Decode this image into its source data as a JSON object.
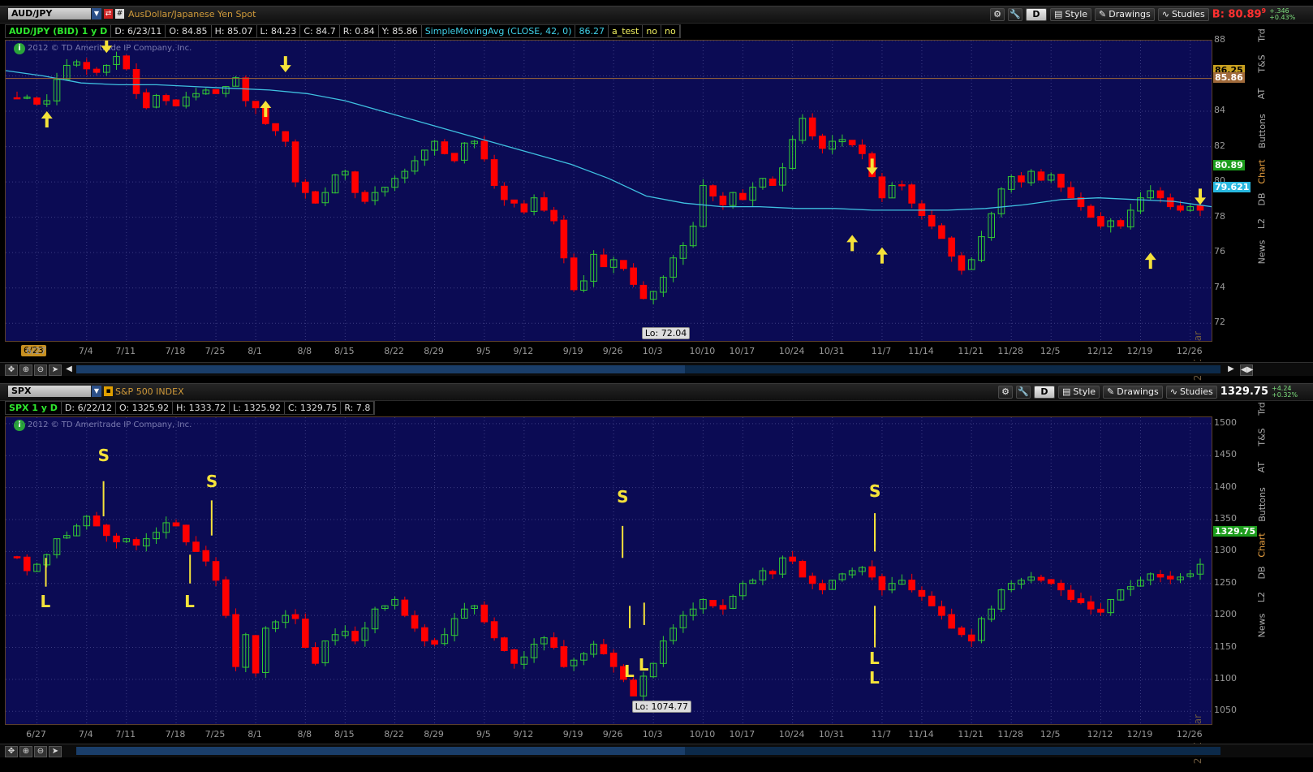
{
  "top": {
    "symbol": "AUD/JPY",
    "description": "AusDollar/Japanese Yen Spot",
    "toolbar": {
      "d_label": "D",
      "style_label": "Style",
      "drawings_label": "Drawings",
      "studies_label": "Studies"
    },
    "bid": "B: 80.89",
    "bid_sup": "9",
    "change_abs": "+.346",
    "change_pct": "+0.43%",
    "info_bar": [
      "AUD/JPY (BID) 1 y D",
      "D: 6/23/11",
      "O: 84.85",
      "H: 85.07",
      "L: 84.23",
      "C: 84.7",
      "R: 0.84",
      "Y: 85.86"
    ],
    "study": "SimpleMovingAvg (CLOSE, 42, 0)",
    "study_value": "86.27",
    "extra": [
      "a_test",
      "no",
      "no"
    ],
    "copyright": "2012 © TD Ameritrade IP Company, Inc.",
    "year_label": "2011 year",
    "date_badge": "6/23",
    "lo_label": "Lo: 72.04",
    "price_badges": {
      "a": "86.25",
      "b": "85.86",
      "last": "80.89",
      "sma": "79.621"
    }
  },
  "bottom": {
    "symbol": "SPX",
    "description": "S&P 500 INDEX",
    "toolbar": {
      "d_label": "D",
      "style_label": "Style",
      "drawings_label": "Drawings",
      "studies_label": "Studies"
    },
    "last": "1329.75",
    "change_abs": "+4.24",
    "change_pct": "+0.32%",
    "info_bar": [
      "SPX 1 y D",
      "D: 6/22/12",
      "O: 1325.92",
      "H: 1333.72",
      "L: 1325.92",
      "C: 1329.75",
      "R: 7.8"
    ],
    "copyright": "2012 © TD Ameritrade IP Company, Inc.",
    "year_label": "2011 year",
    "lo_label": "Lo: 1074.77",
    "price_badge": "1329.75"
  },
  "side_tabs": [
    "Trd",
    "T&S",
    "AT",
    "Buttons",
    "Chart",
    "DB",
    "L2",
    "News"
  ],
  "icons": {
    "symbol_dropdown": "chevron-down-icon",
    "gadget": "gear-icon",
    "wrench": "wrench-icon",
    "style": "style-icon",
    "drawings": "pencil-icon",
    "studies": "studies-icon",
    "info": "info-icon",
    "pan": "pan-icon",
    "zoom_in": "zoom-in-icon",
    "zoom_out": "zoom-out-icon",
    "pointer": "pointer-icon",
    "scroll_left": "arrow-left-icon",
    "scroll_right": "arrow-right-icon",
    "expand": "expand-icon"
  },
  "colors": {
    "bg": "#0b0b54",
    "up": "#33cc33",
    "down": "#ff0000",
    "sma": "#3fc0e0",
    "signal": "#f5e23a",
    "frame": "#5a3f2a"
  },
  "chart_data": [
    {
      "type": "candlestick",
      "title": "AUD/JPY (BID) 1 y D",
      "ylim": [
        71,
        88
      ],
      "y_ticks": [
        72,
        74,
        76,
        78,
        80,
        82,
        84,
        86,
        88
      ],
      "x_ticks": [
        "6/27",
        "7/4",
        "7/11",
        "7/18",
        "7/25",
        "8/1",
        "8/8",
        "8/15",
        "8/22",
        "8/29",
        "9/5",
        "9/12",
        "9/19",
        "9/26",
        "10/3",
        "10/10",
        "10/17",
        "10/24",
        "10/31",
        "11/7",
        "11/14",
        "11/21",
        "11/28",
        "12/5",
        "12/12",
        "12/19",
        "12/26"
      ],
      "closes": [
        84.7,
        84.8,
        84.4,
        84.6,
        85.8,
        86.6,
        86.8,
        86.4,
        86.2,
        86.6,
        87.1,
        86.4,
        85.0,
        84.2,
        84.9,
        84.6,
        84.3,
        84.8,
        85.0,
        85.2,
        85.0,
        85.4,
        85.9,
        84.6,
        84.2,
        83.3,
        82.9,
        82.3,
        80.0,
        79.4,
        78.8,
        79.4,
        80.4,
        80.6,
        79.4,
        78.9,
        79.4,
        79.7,
        80.2,
        80.6,
        81.2,
        81.8,
        82.3,
        81.6,
        81.2,
        82.2,
        82.3,
        81.3,
        79.8,
        79.0,
        78.8,
        78.3,
        79.1,
        78.4,
        77.8,
        75.7,
        73.9,
        74.4,
        75.9,
        75.2,
        75.6,
        75.1,
        74.2,
        73.4,
        73.8,
        74.6,
        75.7,
        76.4,
        77.5,
        79.8,
        79.2,
        78.7,
        79.4,
        79.0,
        79.7,
        80.2,
        79.8,
        80.8,
        82.4,
        83.6,
        82.6,
        81.9,
        82.3,
        82.4,
        82.1,
        81.6,
        80.3,
        79.1,
        79.8,
        79.8,
        78.8,
        78.1,
        77.5,
        76.8,
        75.8,
        75.0,
        75.6,
        76.9,
        78.2,
        79.6,
        80.3,
        80.0,
        80.6,
        80.1,
        80.4,
        79.7,
        79.1,
        78.6,
        78.0,
        77.5,
        77.8,
        77.5,
        78.4,
        79.1,
        79.5,
        79.1,
        78.6,
        78.4,
        78.6,
        78.4
      ],
      "sma": [
        86.3,
        86.0,
        85.6,
        85.5,
        85.5,
        85.4,
        85.3,
        85.2,
        85.0,
        84.6,
        84.0,
        83.4,
        82.8,
        82.2,
        81.6,
        81.0,
        80.2,
        79.2,
        78.8,
        78.6,
        78.6,
        78.5,
        78.5,
        78.4,
        78.4,
        78.4,
        78.5,
        78.7,
        79.0,
        79.1,
        79.0,
        78.9,
        78.6
      ],
      "arrows_up": [
        [
          3,
          84
        ],
        [
          25,
          84.6
        ],
        [
          84,
          77
        ],
        [
          87,
          76.3
        ],
        [
          114,
          76
        ],
        [
          137,
          76
        ],
        [
          148,
          76.7
        ]
      ],
      "arrows_down": [
        [
          9,
          87.3
        ],
        [
          27,
          86.2
        ],
        [
          86,
          80.4
        ],
        [
          119,
          78.7
        ],
        [
          125,
          79.5
        ]
      ]
    },
    {
      "type": "candlestick",
      "title": "SPX 1 y D",
      "ylim": [
        1030,
        1510
      ],
      "y_ticks": [
        1050,
        1100,
        1150,
        1200,
        1250,
        1300,
        1350,
        1400,
        1450,
        1500
      ],
      "x_ticks": [
        "6/27",
        "7/4",
        "7/11",
        "7/18",
        "7/25",
        "8/1",
        "8/8",
        "8/15",
        "8/22",
        "8/29",
        "9/5",
        "9/12",
        "9/19",
        "9/26",
        "10/3",
        "10/10",
        "10/17",
        "10/24",
        "10/31",
        "11/7",
        "11/14",
        "11/21",
        "11/28",
        "12/5",
        "12/12",
        "12/19",
        "12/26"
      ],
      "closes": [
        1290,
        1270,
        1280,
        1295,
        1320,
        1325,
        1340,
        1355,
        1340,
        1325,
        1315,
        1320,
        1310,
        1320,
        1330,
        1345,
        1340,
        1315,
        1300,
        1285,
        1255,
        1200,
        1120,
        1170,
        1110,
        1180,
        1190,
        1200,
        1195,
        1150,
        1125,
        1160,
        1170,
        1175,
        1160,
        1180,
        1210,
        1215,
        1225,
        1200,
        1180,
        1160,
        1155,
        1170,
        1195,
        1210,
        1215,
        1190,
        1165,
        1145,
        1125,
        1135,
        1155,
        1165,
        1150,
        1120,
        1130,
        1140,
        1155,
        1140,
        1120,
        1100,
        1074,
        1105,
        1125,
        1160,
        1180,
        1200,
        1210,
        1225,
        1215,
        1210,
        1230,
        1250,
        1255,
        1270,
        1265,
        1290,
        1285,
        1260,
        1250,
        1240,
        1255,
        1265,
        1270,
        1275,
        1260,
        1240,
        1250,
        1255,
        1240,
        1230,
        1215,
        1200,
        1180,
        1170,
        1160,
        1195,
        1210,
        1240,
        1250,
        1255,
        1260,
        1255,
        1250,
        1240,
        1225,
        1220,
        1210,
        1205,
        1225,
        1240,
        1245,
        1255,
        1265,
        1260,
        1257,
        1260,
        1265,
        1280
      ]
    }
  ]
}
